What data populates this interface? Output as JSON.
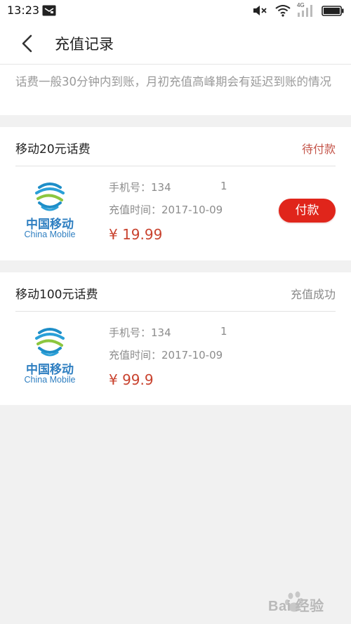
{
  "status_bar": {
    "time": "13:23",
    "network": "4G"
  },
  "header": {
    "title": "充值记录",
    "back_icon": "chevron-left-icon"
  },
  "notice": {
    "text": "话费一般30分钟内到账，月初充值高峰期会有延迟到账的情况"
  },
  "records": [
    {
      "product": "移动20元话费",
      "status": "待付款",
      "status_color": "#c4554a",
      "operator_cn": "中国移动",
      "operator_en": "China Mobile",
      "phone_label": "手机号：134",
      "phone_tail": "1",
      "time_label": "充值时间：2017-10-09",
      "price": "¥ 19.99",
      "pay_label": "付款",
      "pay_color": "#e0251b"
    },
    {
      "product": "移动100元话费",
      "status": "充值成功",
      "status_color": "#8a8a8a",
      "operator_cn": "中国移动",
      "operator_en": "China Mobile",
      "phone_label": "手机号：134",
      "phone_tail": "1",
      "time_label": "充值时间：2017-10-09",
      "price": "¥ 99.9"
    }
  ],
  "watermark": {
    "text": "Bai 经验"
  }
}
